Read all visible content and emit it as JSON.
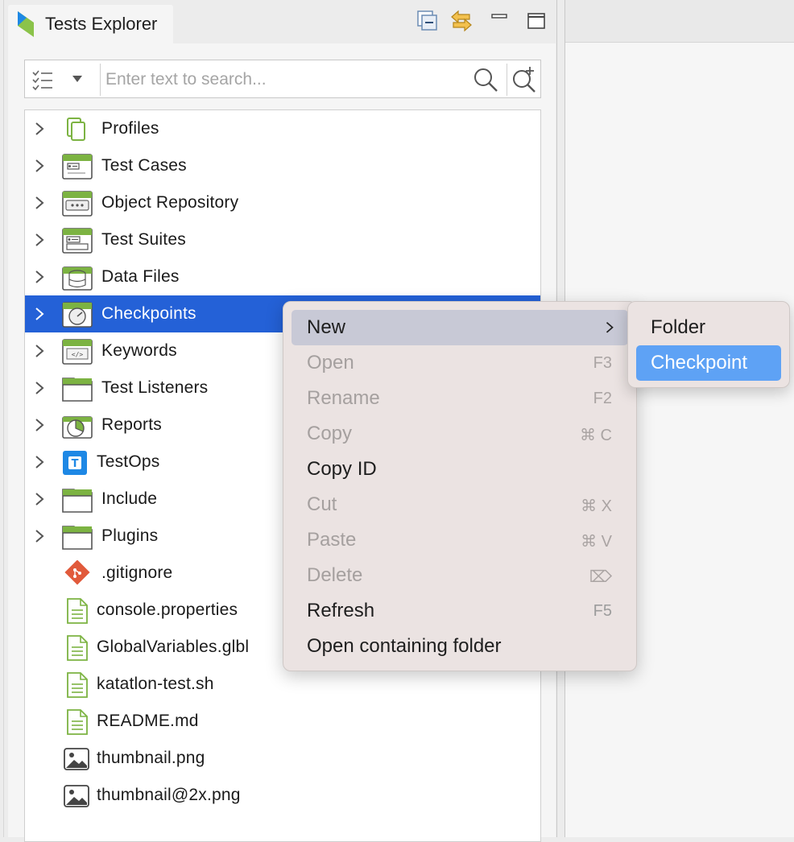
{
  "panel": {
    "title": "Tests Explorer",
    "toolbar": {
      "collapse_icon": "collapse-all-icon",
      "link_icon": "link-with-editor-icon",
      "minimize_icon": "minimize-icon",
      "maximize_icon": "maximize-icon"
    }
  },
  "search": {
    "placeholder": "Enter text to search...",
    "value": ""
  },
  "tree": {
    "items": [
      {
        "label": "Profiles",
        "icon": "profiles-icon",
        "expandable": true
      },
      {
        "label": "Test Cases",
        "icon": "test-cases-icon",
        "expandable": true
      },
      {
        "label": "Object Repository",
        "icon": "object-repository-icon",
        "expandable": true
      },
      {
        "label": "Test Suites",
        "icon": "test-suites-icon",
        "expandable": true
      },
      {
        "label": "Data Files",
        "icon": "data-files-icon",
        "expandable": true
      },
      {
        "label": "Checkpoints",
        "icon": "checkpoints-icon",
        "expandable": true,
        "selected": true
      },
      {
        "label": "Keywords",
        "icon": "keywords-icon",
        "expandable": true
      },
      {
        "label": "Test Listeners",
        "icon": "folder-icon",
        "expandable": true
      },
      {
        "label": "Reports",
        "icon": "reports-icon",
        "expandable": true
      },
      {
        "label": "TestOps",
        "icon": "testops-icon",
        "expandable": true
      },
      {
        "label": "Include",
        "icon": "folder-icon",
        "expandable": true
      },
      {
        "label": "Plugins",
        "icon": "folder-icon",
        "expandable": true
      },
      {
        "label": ".gitignore",
        "icon": "git-icon",
        "expandable": false
      },
      {
        "label": "console.properties",
        "icon": "text-file-icon",
        "expandable": false
      },
      {
        "label": "GlobalVariables.glbl",
        "icon": "text-file-icon",
        "expandable": false
      },
      {
        "label": "katatlon-test.sh",
        "icon": "text-file-icon",
        "expandable": false
      },
      {
        "label": "README.md",
        "icon": "text-file-icon",
        "expandable": false
      },
      {
        "label": "thumbnail.png",
        "icon": "image-file-icon",
        "expandable": false
      },
      {
        "label": "thumbnail@2x.png",
        "icon": "image-file-icon",
        "expandable": false
      }
    ]
  },
  "context_menu": {
    "items": [
      {
        "label": "New",
        "shortcut": "",
        "enabled": true,
        "submenu": true
      },
      {
        "label": "Open",
        "shortcut": "F3",
        "enabled": false
      },
      {
        "label": "Rename",
        "shortcut": "F2",
        "enabled": false
      },
      {
        "label": "Copy",
        "shortcut": "⌘ C",
        "enabled": false
      },
      {
        "label": "Copy ID",
        "shortcut": "",
        "enabled": true
      },
      {
        "label": "Cut",
        "shortcut": "⌘ X",
        "enabled": false
      },
      {
        "label": "Paste",
        "shortcut": "⌘ V",
        "enabled": false
      },
      {
        "label": "Delete",
        "shortcut": "⌦",
        "enabled": false
      },
      {
        "label": "Refresh",
        "shortcut": "F5",
        "enabled": true
      },
      {
        "label": "Open containing folder",
        "shortcut": "",
        "enabled": true
      }
    ]
  },
  "submenu": {
    "items": [
      {
        "label": "Folder"
      },
      {
        "label": "Checkpoint",
        "active": true
      }
    ]
  },
  "colors": {
    "selection": "#2461d7",
    "submenu_active": "#5ea2f5",
    "menu_bg": "#ebe3e2",
    "icon_green": "#7cb342"
  }
}
